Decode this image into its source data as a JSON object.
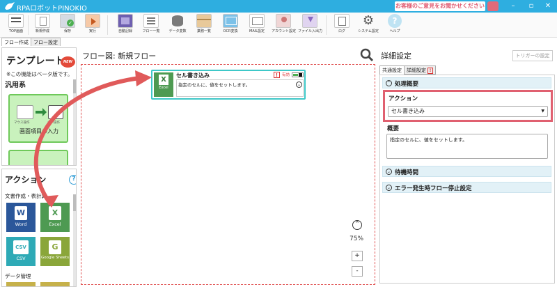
{
  "window": {
    "title": "RPAロボットPINOKIO",
    "feedback": "お客様のご意見をお聞かせください"
  },
  "toolbar": [
    {
      "id": "top",
      "label": "TOP画面",
      "icon": "top-screen-icon"
    },
    {
      "id": "new",
      "label": "新規作成",
      "icon": "new-doc-icon"
    },
    {
      "id": "save",
      "label": "保存",
      "icon": "save-icon"
    },
    {
      "id": "run",
      "label": "実行",
      "icon": "run-icon"
    },
    {
      "id": "record",
      "label": "自動記録",
      "icon": "film-icon"
    },
    {
      "id": "flowlist",
      "label": "フロー一覧",
      "icon": "list-icon"
    },
    {
      "id": "datavar",
      "label": "データ変数",
      "icon": "database-icon"
    },
    {
      "id": "package",
      "label": "業務一覧",
      "icon": "box-icon"
    },
    {
      "id": "ocr",
      "label": "OCR変換",
      "icon": "ocr-icon"
    },
    {
      "id": "mail",
      "label": "MAIL設定",
      "icon": "mail-icon"
    },
    {
      "id": "account",
      "label": "アカウント設定",
      "icon": "account-icon"
    },
    {
      "id": "file",
      "label": "ファイル入出力",
      "icon": "download-icon"
    },
    {
      "id": "log",
      "label": "ログ",
      "icon": "log-icon"
    },
    {
      "id": "system",
      "label": "システム設定",
      "icon": "gear-icon"
    },
    {
      "id": "help",
      "label": "ヘルプ",
      "icon": "help-icon"
    }
  ],
  "left_tabs": [
    "フロー作成",
    "フロー設定"
  ],
  "template": {
    "title": "テンプレート",
    "new_badge": "NEW",
    "note": "※この機能はベータ版です。",
    "category": "汎用系",
    "card_mini_left": "マウス操作",
    "card_mini_right": "キー操作",
    "card_label": "画面項目の入力"
  },
  "actions": {
    "title": "アクション",
    "help": "?",
    "category": "文書作成・表計算",
    "cards": [
      {
        "label": "Word",
        "glyph": "W",
        "color": "#2b579a"
      },
      {
        "label": "Excel",
        "glyph": "X",
        "color": "#4e9a52"
      },
      {
        "label": "CSV",
        "glyph": "CSV",
        "color": "#2eaab6"
      },
      {
        "label": "Google Sheets",
        "glyph": "G",
        "color": "#8aa63a"
      }
    ],
    "data_category": "データ管理"
  },
  "flow": {
    "title": "フロー図:  新規フロー",
    "zoom": "75%",
    "plus": "+",
    "minus": "-",
    "node": {
      "title": "セル書き込み",
      "icon_label": "Excel",
      "icon_glyph": "X",
      "warn": "!",
      "status": "有効",
      "description": "指定のセルに、値をセットします。"
    }
  },
  "detail": {
    "title": "詳細設定",
    "trigger_button": "トリガーの設定",
    "tabs": [
      "共通設定",
      "詳細設定"
    ],
    "tab_warn": "!",
    "section_overview": "処理概要",
    "action_label": "アクション",
    "action_value": "セル書き込み",
    "summary_label": "概要",
    "summary_value": "指定のセルに、値をセットします。",
    "section_wait": "待機時間",
    "section_error": "エラー発生時フロー停止設定"
  },
  "colors": {
    "title_bar": "#2eaee0",
    "highlight": "#e06070",
    "node_border": "#3ec8c8",
    "arrow": "#e05a5a"
  }
}
